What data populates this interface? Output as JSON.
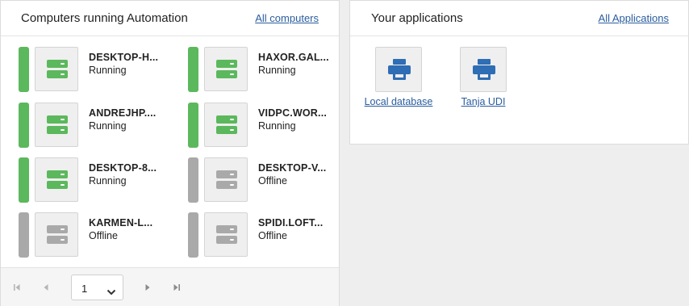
{
  "left_panel": {
    "title": "Computers running Automation",
    "link": "All computers",
    "computers": [
      {
        "name": "DESKTOP-H...",
        "status": "Running"
      },
      {
        "name": "HAXOR.GAL...",
        "status": "Running"
      },
      {
        "name": "ANDREJHP....",
        "status": "Running"
      },
      {
        "name": "VIDPC.WOR...",
        "status": "Running"
      },
      {
        "name": "DESKTOP-8...",
        "status": "Running"
      },
      {
        "name": "DESKTOP-V...",
        "status": "Offline"
      },
      {
        "name": "KARMEN-L...",
        "status": "Offline"
      },
      {
        "name": "SPIDI.LOFT...",
        "status": "Offline"
      }
    ],
    "pager": {
      "page": "1"
    }
  },
  "right_panel": {
    "title": "Your applications",
    "link": "All Applications",
    "apps": [
      {
        "label": "Local database",
        "icon": "printer-icon"
      },
      {
        "label": "Tanja UDI",
        "icon": "printer-icon"
      }
    ]
  },
  "colors": {
    "running": "#5cb85c",
    "offline": "#a9a9a9",
    "link": "#2a5d9f",
    "app_icon": "#2f6db5"
  }
}
